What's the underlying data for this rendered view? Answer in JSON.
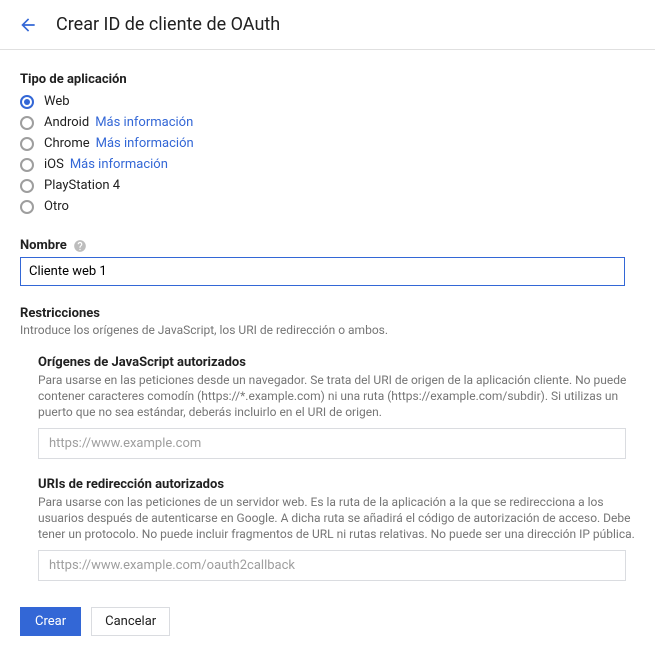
{
  "header": {
    "title": "Crear ID de cliente de OAuth"
  },
  "appType": {
    "label": "Tipo de aplicación",
    "options": [
      {
        "label": "Web",
        "selected": true,
        "info": ""
      },
      {
        "label": "Android",
        "selected": false,
        "info": "Más información"
      },
      {
        "label": "Chrome",
        "selected": false,
        "info": "Más información"
      },
      {
        "label": "iOS",
        "selected": false,
        "info": "Más información"
      },
      {
        "label": "PlayStation 4",
        "selected": false,
        "info": ""
      },
      {
        "label": "Otro",
        "selected": false,
        "info": ""
      }
    ]
  },
  "name": {
    "label": "Nombre",
    "value": "Cliente web 1"
  },
  "restrictions": {
    "title": "Restricciones",
    "desc": "Introduce los orígenes de JavaScript, los URI de redirección o ambos.",
    "jsOrigins": {
      "title": "Orígenes de JavaScript autorizados",
      "desc": "Para usarse en las peticiones desde un navegador. Se trata del URI de origen de la aplicación cliente. No puede contener caracteres comodín (https://*.example.com) ni una ruta (https://example.com/subdir). Si utilizas un puerto que no sea estándar, deberás incluirlo en el URI de origen.",
      "placeholder": "https://www.example.com"
    },
    "redirectUris": {
      "title": "URIs de redirección autorizados",
      "desc": "Para usarse con las peticiones de un servidor web. Es la ruta de la aplicación a la que se redirecciona a los usuarios después de autenticarse en Google. A dicha ruta se añadirá el código de autorización de acceso. Debe tener un protocolo. No puede incluir fragmentos de URL ni rutas relativas. No puede ser una dirección IP pública.",
      "placeholder": "https://www.example.com/oauth2callback"
    }
  },
  "actions": {
    "create": "Crear",
    "cancel": "Cancelar"
  }
}
